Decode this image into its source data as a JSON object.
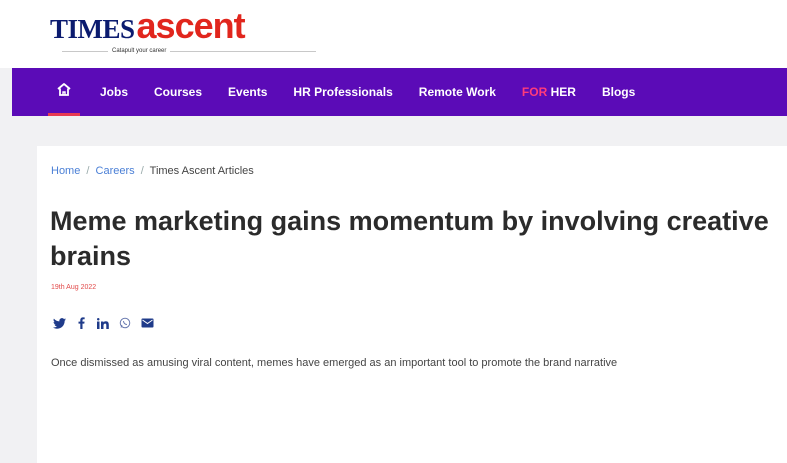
{
  "brand": {
    "times": "TIMES",
    "ascent": "ascent",
    "tagline": "Catapult your career"
  },
  "nav": {
    "home_icon": "home-icon",
    "items": [
      "Jobs",
      "Courses",
      "Events",
      "HR Professionals",
      "Remote Work"
    ],
    "for_her": {
      "part1": "FOR",
      "part2": "HER"
    },
    "blogs": "Blogs"
  },
  "breadcrumb": {
    "home": "Home",
    "careers": "Careers",
    "current": "Times Ascent Articles",
    "separator": "/"
  },
  "article": {
    "title": "Meme marketing gains momentum by involving creative brains",
    "date": "19th Aug 2022",
    "excerpt": "Once dismissed as amusing viral content, memes have emerged as an important tool to promote the brand narrative"
  },
  "social": {
    "icons": [
      "twitter-icon",
      "facebook-icon",
      "linkedin-icon",
      "whatsapp-icon",
      "email-icon"
    ]
  },
  "colors": {
    "nav_bg": "#5b0bb7",
    "brand_red": "#e1261d",
    "brand_navy": "#0b1b6f",
    "for_her": "#ff3b7a"
  }
}
